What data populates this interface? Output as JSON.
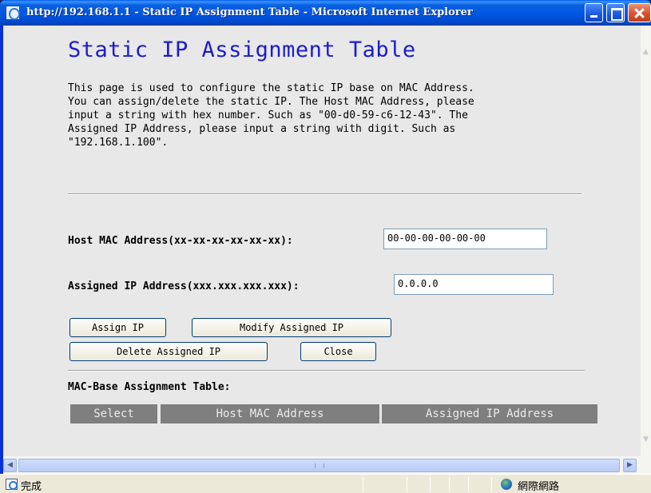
{
  "window": {
    "title": "http://192.168.1.1 - Static IP Assignment Table - Microsoft Internet Explorer"
  },
  "page": {
    "heading": "Static IP Assignment Table",
    "description_lines": [
      "This page is used to configure the static IP base on MAC Address.",
      "You can assign/delete the static IP. The Host MAC Address, please",
      "input a string with hex number. Such as \"00-d0-59-c6-12-43\". The",
      "Assigned IP Address, please input a string with digit. Such as",
      "\"192.168.1.100\"."
    ]
  },
  "form": {
    "mac_label": "Host MAC Address(xx-xx-xx-xx-xx-xx):",
    "mac_value": "00-00-00-00-00-00",
    "ip_label": "Assigned IP Address(xxx.xxx.xxx.xxx):",
    "ip_value": "0.0.0.0"
  },
  "buttons": {
    "assign": "Assign IP",
    "modify": "Modify Assigned IP",
    "delete": "Delete Assigned IP",
    "close": "Close"
  },
  "table": {
    "title": "MAC-Base Assignment Table:",
    "headers": [
      "Select",
      "Host MAC Address",
      "Assigned IP Address"
    ]
  },
  "statusbar": {
    "status": "完成",
    "zone": "網際網路"
  },
  "icons": {
    "title": "ie-page-icon",
    "status": "ie-page-icon",
    "zone": "internet-globe-icon"
  },
  "colors": {
    "heading": "#1b1bd0",
    "page_background": "#e8e8e8",
    "table_header": "#7f7f7f",
    "titlebar": "#0054e3"
  }
}
